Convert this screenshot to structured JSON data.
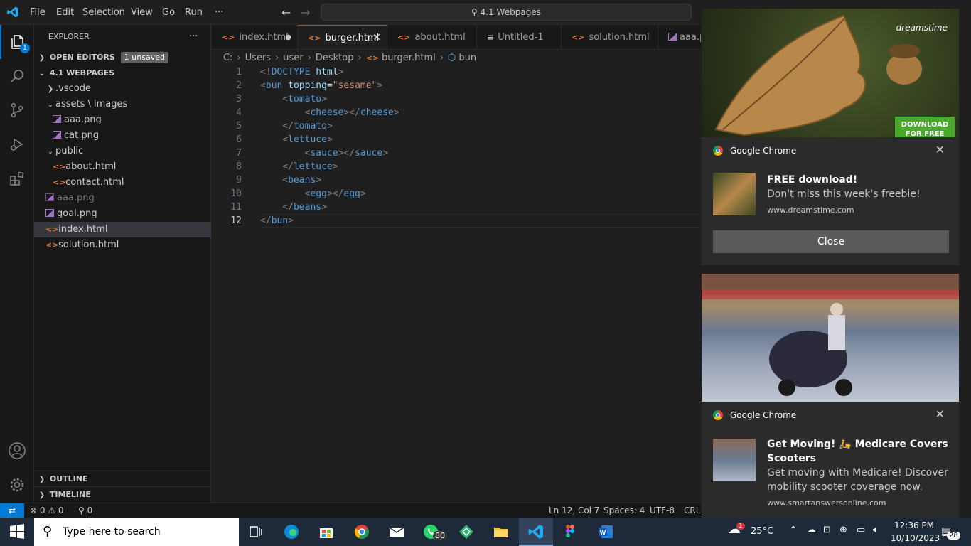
{
  "titlebar": {
    "menus": [
      "File",
      "Edit",
      "Selection",
      "View",
      "Go",
      "Run",
      "···"
    ],
    "command_center": "4.1 Webpages"
  },
  "activity": {
    "explorer_badge": "1"
  },
  "sidebar": {
    "title": "EXPLORER",
    "more": "···",
    "open_editors": "OPEN EDITORS",
    "unsaved": "1 unsaved",
    "folder": "4.1 WEBPAGES",
    "items": [
      {
        "label": ".vscode",
        "kind": "folder"
      },
      {
        "label": "assets \\ images",
        "kind": "folder-open"
      },
      {
        "label": "aaa.png",
        "kind": "image"
      },
      {
        "label": "cat.png",
        "kind": "image"
      },
      {
        "label": "public",
        "kind": "folder-open"
      },
      {
        "label": "about.html",
        "kind": "html"
      },
      {
        "label": "contact.html",
        "kind": "html"
      },
      {
        "label": "aaa.png",
        "kind": "image-dim"
      },
      {
        "label": "goal.png",
        "kind": "image"
      },
      {
        "label": "index.html",
        "kind": "html"
      },
      {
        "label": "solution.html",
        "kind": "html"
      }
    ],
    "outline": "OUTLINE",
    "timeline": "TIMELINE"
  },
  "tabs": [
    "index.html",
    "burger.html",
    "about.html",
    "Untitled-1",
    "solution.html",
    "aaa.p"
  ],
  "breadcrumb": [
    "C:",
    "Users",
    "user",
    "Desktop",
    "burger.html",
    "bun"
  ],
  "editor": {
    "line_numbers": [
      "1",
      "2",
      "3",
      "4",
      "5",
      "6",
      "7",
      "8",
      "9",
      "10",
      "11",
      "12"
    ]
  },
  "statusbar": {
    "problems": "⊗ 0 ⚠ 0",
    "ports": "⚲ 0",
    "position": "Ln 12, Col 7",
    "spaces": "Spaces: 4",
    "encoding": "UTF-8",
    "eol": "CRLF"
  },
  "notifications": {
    "brand": "dreamstime",
    "download": "DOWNLOAD FOR FREE",
    "n1": {
      "app": "Google Chrome",
      "title": "FREE download!",
      "body": "Don't miss this week's freebie!",
      "url": "www.dreamstime.com",
      "close": "Close"
    },
    "n2": {
      "app": "Google Chrome",
      "title": "Get Moving! 🛵 Medicare Covers Scooters",
      "body": "Get moving with Medicare! Discover mobility scooter coverage now.",
      "url": "www.smartanswersonline.com"
    }
  },
  "taskbar": {
    "search_placeholder": "Type here to search",
    "whatsapp_badge": "80",
    "weather": "25°C",
    "weather_badge": "1",
    "time": "12:36 PM",
    "date": "10/10/2023",
    "notif_count": "28"
  }
}
